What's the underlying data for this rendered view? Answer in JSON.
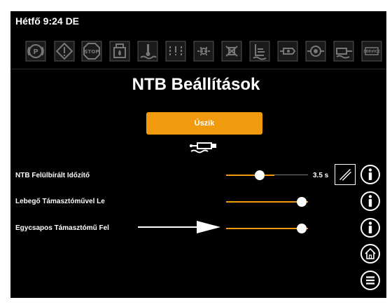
{
  "status": {
    "clock": "Hétfő 9:24 DE"
  },
  "indicators": [
    {
      "icon": "parking-brake-icon",
      "text": "(P)"
    },
    {
      "icon": "warning-icon",
      "text": "!"
    },
    {
      "icon": "stop-icon",
      "text": "STOP"
    },
    {
      "icon": "hydraulic-fluid-icon",
      "text": ""
    },
    {
      "icon": "coolant-temp-icon",
      "text": ""
    },
    {
      "icon": "transmission-warning-icon",
      "text": ""
    },
    {
      "icon": "hydraulic-system-icon",
      "text": ""
    },
    {
      "icon": "filter-icon",
      "text": ""
    },
    {
      "icon": "fuel-level-icon",
      "text": ""
    },
    {
      "icon": "hydraulic-tank-icon",
      "text": ""
    },
    {
      "icon": "oil-pressure-icon",
      "text": ""
    },
    {
      "icon": "cylinder-icon",
      "text": ""
    },
    {
      "icon": "service-icon",
      "text": "SERVICE"
    }
  ],
  "page": {
    "title": "NTB Beállítások"
  },
  "float_button": {
    "label": "Úszik",
    "icon": "float-cylinder-icon"
  },
  "settings": [
    {
      "label": "NTB Felülbírált Időzítő",
      "value": "3.5 s",
      "level": 0.4,
      "has_reset": true,
      "icon": "info-icon"
    },
    {
      "label": "Lebegő Támasztóművel Le",
      "value": "",
      "level": 1.0,
      "has_reset": false,
      "icon": "info-icon"
    },
    {
      "label": "Egycsapos Támasztómű Fel",
      "value": "",
      "level": 1.0,
      "has_reset": false,
      "icon": "info-icon"
    }
  ],
  "nav": [
    {
      "icon": "home-icon"
    },
    {
      "icon": "menu-icon"
    }
  ],
  "colors": {
    "accent": "#f29a0e",
    "background": "#000000",
    "text": "#ffffff"
  }
}
